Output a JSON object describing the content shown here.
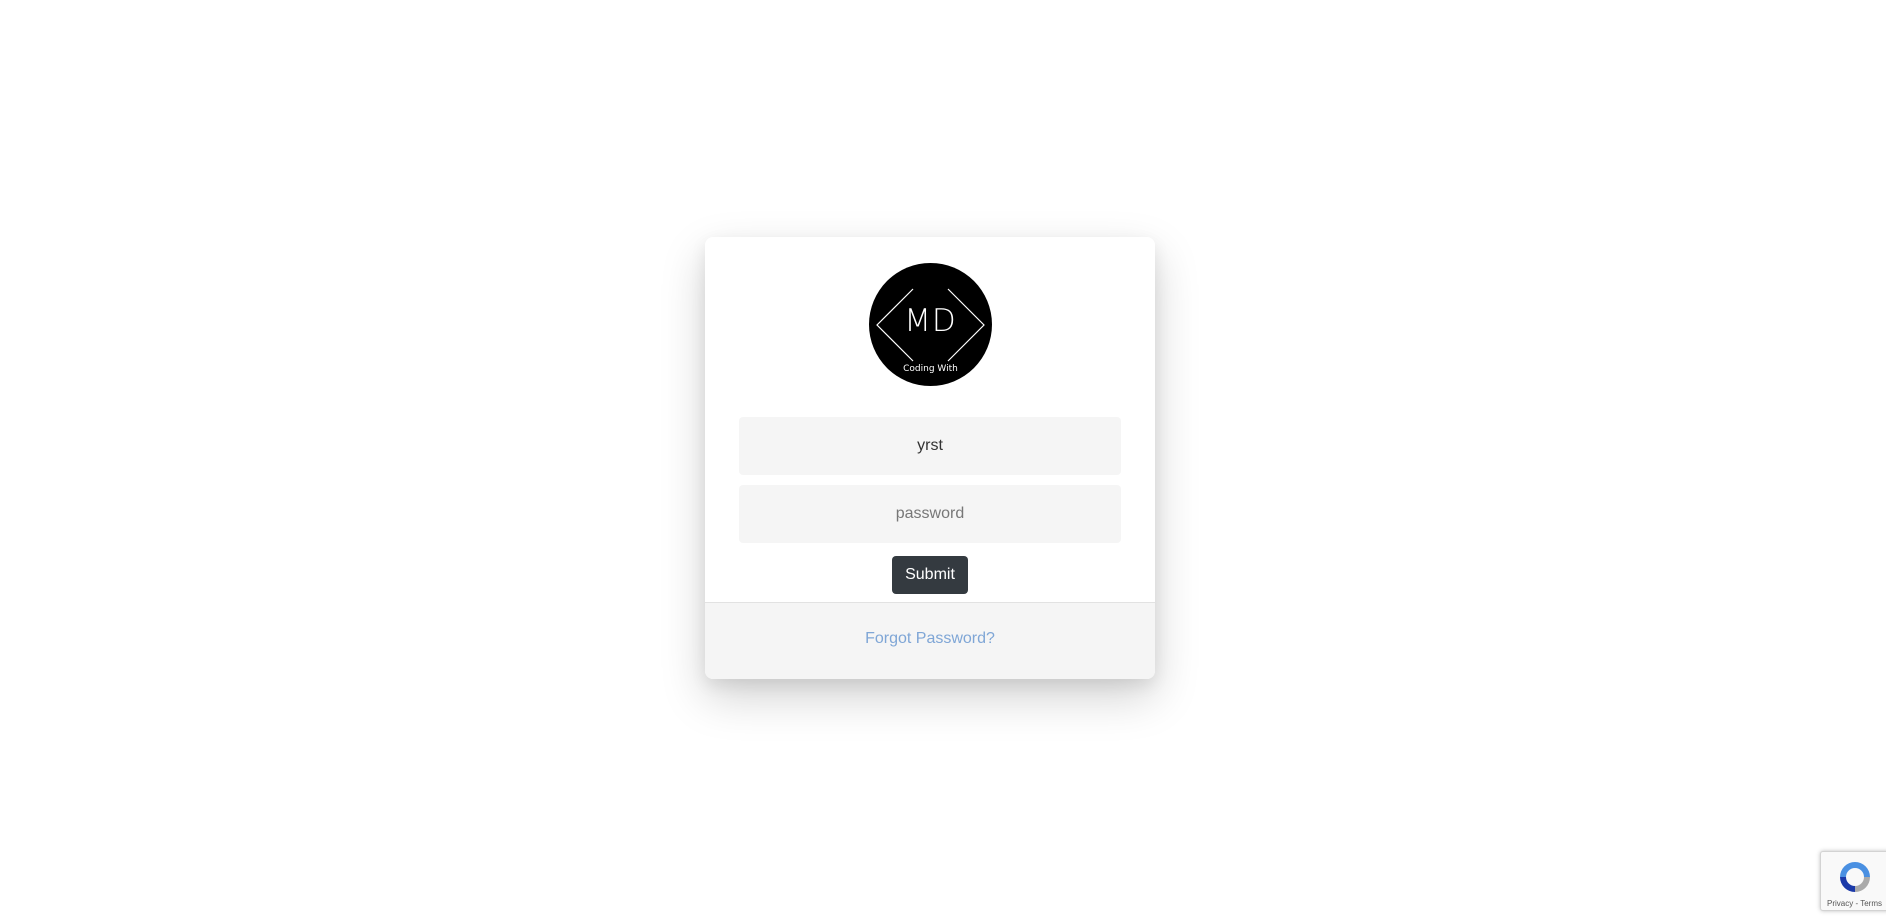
{
  "logo": {
    "main_text": "MD",
    "sub_text": "Coding With",
    "icon": "code-brackets-icon"
  },
  "form": {
    "username_value": "yrst",
    "password_placeholder": "password",
    "submit_label": "Submit"
  },
  "footer": {
    "forgot_label": "Forgot Password?"
  },
  "recaptcha": {
    "icon": "recaptcha-icon",
    "privacy_label": "Privacy",
    "separator": "-",
    "terms_label": "Terms"
  },
  "colors": {
    "submit_bg": "#343a40",
    "link": "#7fa6d6",
    "input_bg": "#f5f5f5"
  }
}
